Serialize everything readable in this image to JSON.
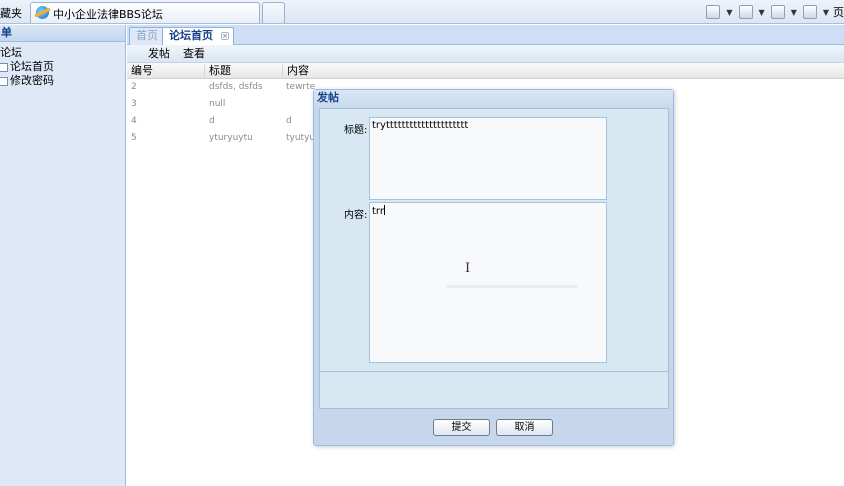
{
  "browser": {
    "favorites_label": "藏夹",
    "tab_title": "中小企业法律BBS论坛"
  },
  "browser_cmd": {
    "page_label": "页"
  },
  "sidebar": {
    "header": "单",
    "items": [
      {
        "label": "论坛"
      },
      {
        "label": "论坛首页"
      },
      {
        "label": "修改密码"
      }
    ]
  },
  "tabs": {
    "home": "首页",
    "forum": "论坛首页"
  },
  "toolbar": {
    "post": "发帖",
    "view": "查看"
  },
  "grid": {
    "columns": [
      "编号",
      "标题",
      "内容"
    ],
    "rows": [
      [
        "2",
        "dsfds, dsfds",
        "tewrte"
      ],
      [
        "3",
        "null",
        ""
      ],
      [
        "4",
        "d",
        "d"
      ],
      [
        "5",
        "yturyuytu",
        "tyutyu"
      ]
    ]
  },
  "dialog": {
    "title": "发帖",
    "title_label": "标题:",
    "title_value": "tryttttttttttttttttttttt",
    "content_label": "内容:",
    "content_value": "trr",
    "submit": "提交",
    "cancel": "取消"
  }
}
